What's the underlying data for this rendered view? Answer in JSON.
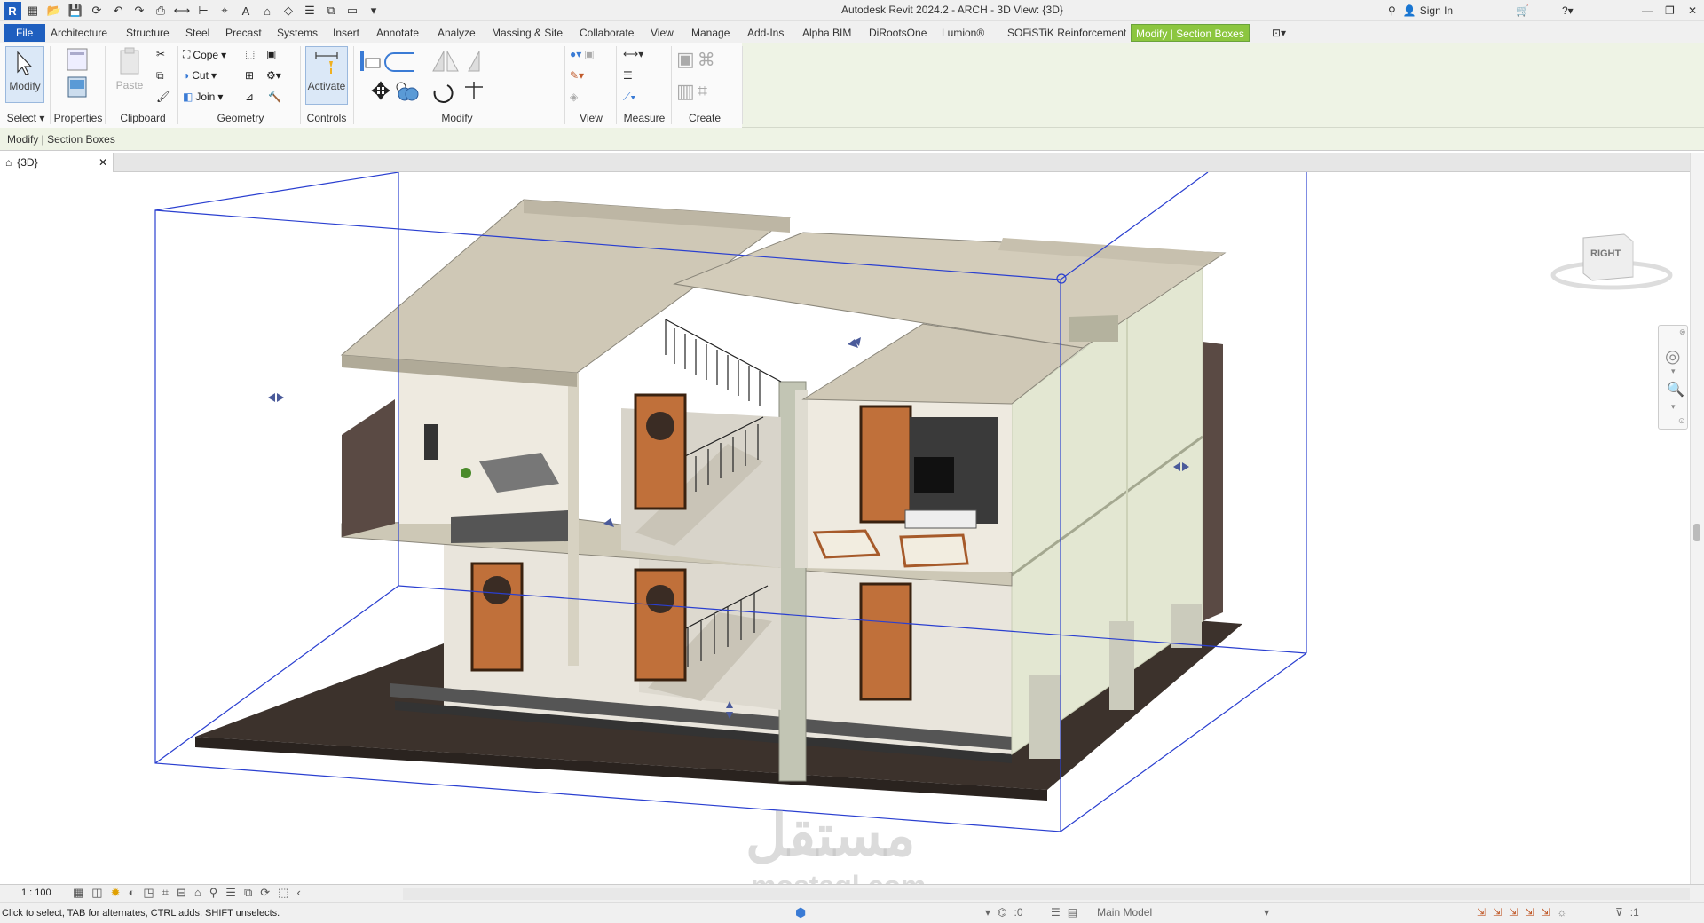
{
  "window": {
    "title": "Autodesk Revit 2024.2 - ARCH - 3D View: {3D}",
    "sign_in": "Sign In",
    "logo": "R"
  },
  "ribbon": {
    "tabs": [
      "File",
      "Architecture",
      "Structure",
      "Steel",
      "Precast",
      "Systems",
      "Insert",
      "Annotate",
      "Analyze",
      "Massing & Site",
      "Collaborate",
      "View",
      "Manage",
      "Add-Ins",
      "Alpha BIM",
      "DiRootsOne",
      "Lumion®",
      "SOFiSTiK Reinforcement",
      "Modify | Section Boxes"
    ],
    "active_tab": "Modify | Section Boxes",
    "select": {
      "modify": "Modify",
      "select_label": "Select"
    },
    "properties": {
      "label": "Properties"
    },
    "clipboard": {
      "paste": "Paste",
      "label": "Clipboard"
    },
    "geometry": {
      "cope": "Cope",
      "cut": "Cut",
      "join": "Join",
      "label": "Geometry"
    },
    "controls": {
      "activate": "Activate",
      "label": "Controls"
    },
    "modify_panel": {
      "label": "Modify"
    },
    "view_panel": {
      "label": "View"
    },
    "measure_panel": {
      "label": "Measure"
    },
    "create_panel": {
      "label": "Create"
    }
  },
  "options_bar": {
    "text": "Modify | Section Boxes"
  },
  "view_tab": {
    "label": "{3D}"
  },
  "viewcube": {
    "face": "RIGHT"
  },
  "view_control_bar": {
    "scale": "1 : 100"
  },
  "status_bar": {
    "message": "Click to select, TAB for alternates, CTRL adds, SHIFT unselects.",
    "worksets": ":0",
    "model": "Main Model",
    "filter": ":1"
  },
  "watermark": {
    "arabic": "مستقل",
    "latin": "mostaql.com"
  },
  "colors": {
    "file_tab": "#1f5fbf",
    "context_tab": "#8cc63f",
    "section_box": "#2a3fd0",
    "floor": "#3c322c",
    "slab": "#cfc8b6",
    "door": "#c0703a"
  }
}
